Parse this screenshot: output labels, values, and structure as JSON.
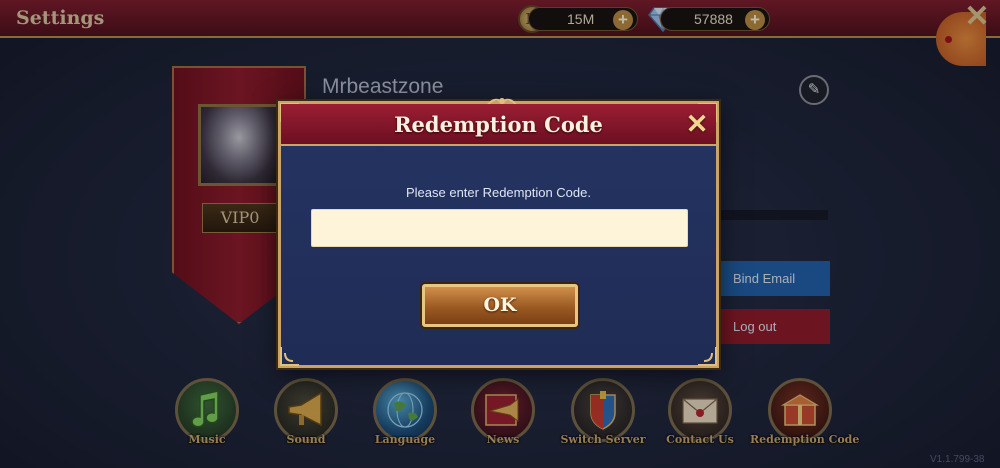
{
  "screen": {
    "title": "Settings",
    "currency": {
      "gold": "15M",
      "gold_icon_glyph": "D",
      "gems": "57888"
    },
    "icons": {
      "gold": "coin-icon",
      "gems": "diamond-icon",
      "plus": "plus-icon",
      "close": "close-icon",
      "edit": "pencil-icon"
    }
  },
  "profile": {
    "username": "Mrbeastzone",
    "vip": "VIP0",
    "actions": {
      "bind_email": "Bind Email",
      "logout": "Log out"
    }
  },
  "menu": [
    {
      "label": "Music",
      "icon": "music-note-icon"
    },
    {
      "label": "Sound",
      "icon": "horn-icon"
    },
    {
      "label": "Language",
      "icon": "globe-icon"
    },
    {
      "label": "News",
      "icon": "trumpet-icon"
    },
    {
      "label": "Switch Server",
      "icon": "shield-flag-icon"
    },
    {
      "label": "Contact Us",
      "icon": "envelope-icon"
    },
    {
      "label": "Redemption Code",
      "icon": "gift-chest-icon"
    }
  ],
  "version": "V1.1.799-38",
  "dialog": {
    "title": "Redemption Code",
    "prompt": "Please enter Redemption Code.",
    "input_value": "",
    "ok_label": "OK"
  },
  "colors": {
    "header_red": "#8b1a2e",
    "panel_blue": "#233160",
    "gold_trim": "#c9a466",
    "input_bg": "#fdf4d9",
    "bind_email_blue": "#1f5fa6",
    "logout_red": "#8e1a26"
  }
}
